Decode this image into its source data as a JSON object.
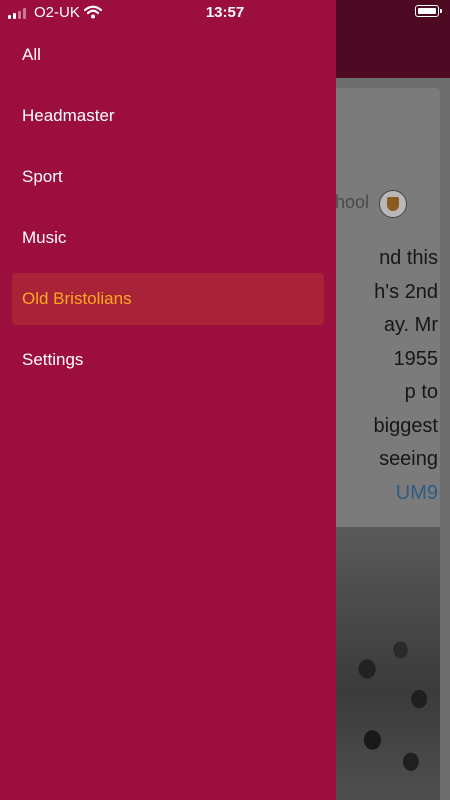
{
  "status_bar": {
    "carrier": "O2-UK",
    "time": "13:57"
  },
  "drawer": {
    "items": [
      {
        "label": "All",
        "active": false
      },
      {
        "label": "Headmaster",
        "active": false
      },
      {
        "label": "Sport",
        "active": false
      },
      {
        "label": "Music",
        "active": false
      },
      {
        "label": "Old Bristolians",
        "active": true
      },
      {
        "label": "Settings",
        "active": false
      }
    ]
  },
  "background_post": {
    "source_fragment": "hool",
    "text_lines": [
      "nd this",
      "h's 2nd",
      "ay. Mr",
      "1955",
      "p to",
      "biggest",
      "seeing"
    ],
    "link_fragment": "UM9"
  },
  "colors": {
    "drawer_bg": "#9c0e3e",
    "active_item_bg": "#a82238",
    "active_item_text": "#ffa91e",
    "header_bg": "#4e0a22"
  }
}
